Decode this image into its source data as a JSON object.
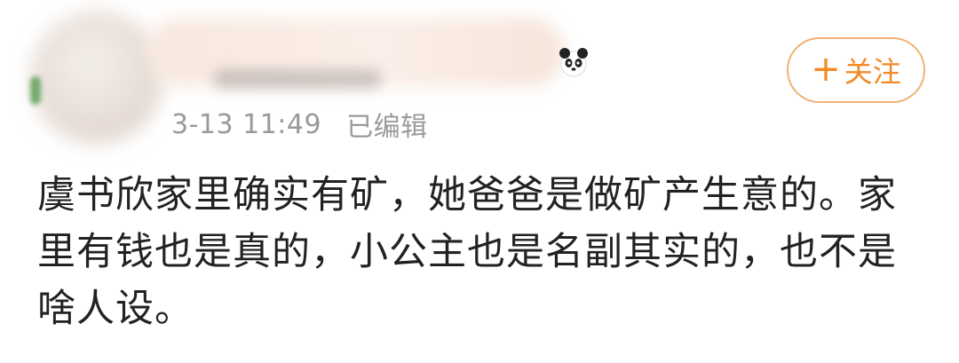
{
  "post": {
    "timestamp": "3-13 11:49",
    "edited_label": "已编辑",
    "follow_button_label": "关注",
    "follow_button_icon": "+",
    "body_text": "虞书欣家里确实有矿，她爸爸是做矿产生意的。家里有钱也是真的，小公主也是名副其实的，也不是啥人设。"
  },
  "colors": {
    "follow_accent": "#f28a26",
    "follow_border": "#f0b274",
    "meta_text": "#9a9a9a",
    "body_text": "#222222"
  },
  "icons": {
    "badge": "panda-icon"
  }
}
